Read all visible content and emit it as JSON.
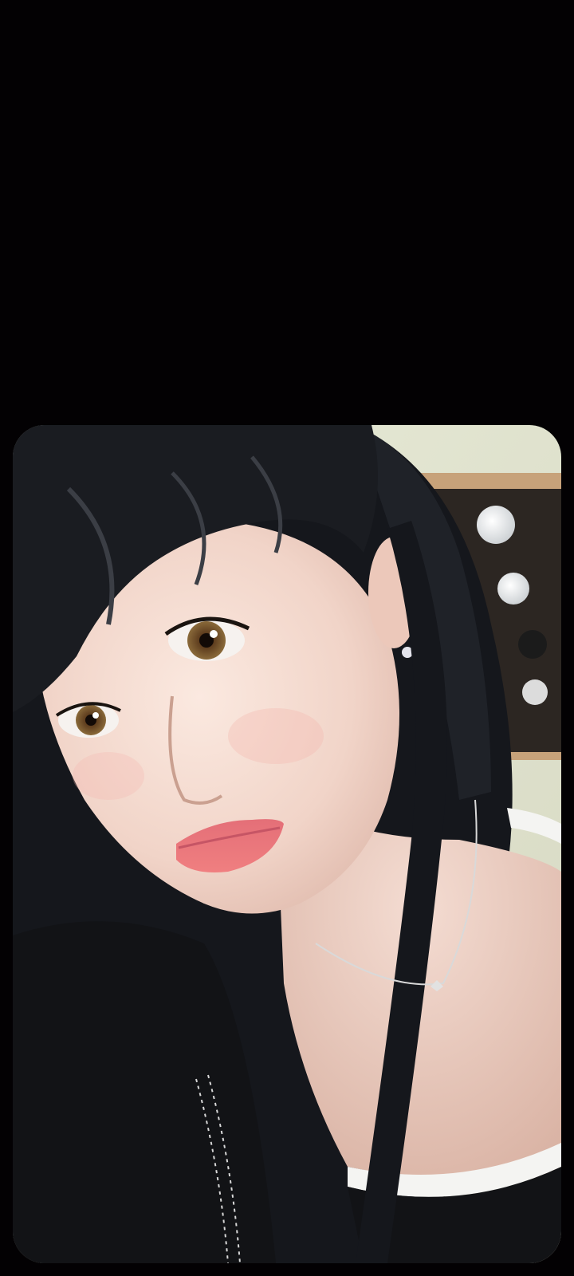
{
  "viewer": {
    "background_color": "#030103",
    "photo": {
      "subject": "photo-selfie"
    }
  }
}
